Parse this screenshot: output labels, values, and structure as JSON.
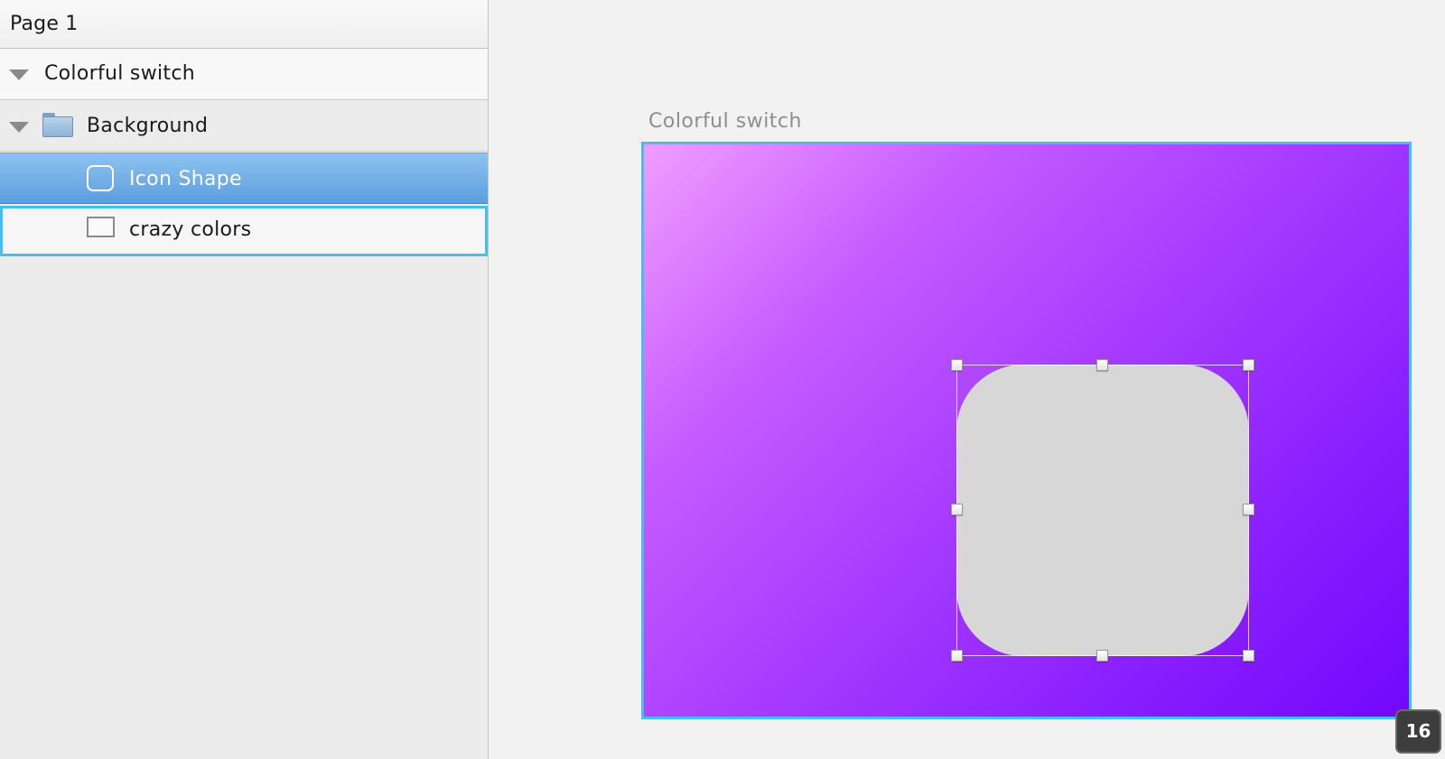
{
  "sidebar": {
    "page_label": "Page 1",
    "layers": [
      {
        "label": "Colorful switch",
        "kind": "artboard",
        "expanded": true
      },
      {
        "label": "Background",
        "kind": "group",
        "expanded": true
      },
      {
        "label": "Icon Shape",
        "kind": "shape",
        "selected": true
      },
      {
        "label": "crazy colors",
        "kind": "rectangle",
        "hovered": true
      }
    ]
  },
  "canvas": {
    "artboard_title": "Colorful switch",
    "gradient_colors": [
      "#f09dff",
      "#c65cff",
      "#a73cff",
      "#8b20ff",
      "#7307fb"
    ],
    "icon_shape_fill": "#d7d7d7",
    "selection_color": "#3ec2f2",
    "zoom_badge": "16"
  }
}
